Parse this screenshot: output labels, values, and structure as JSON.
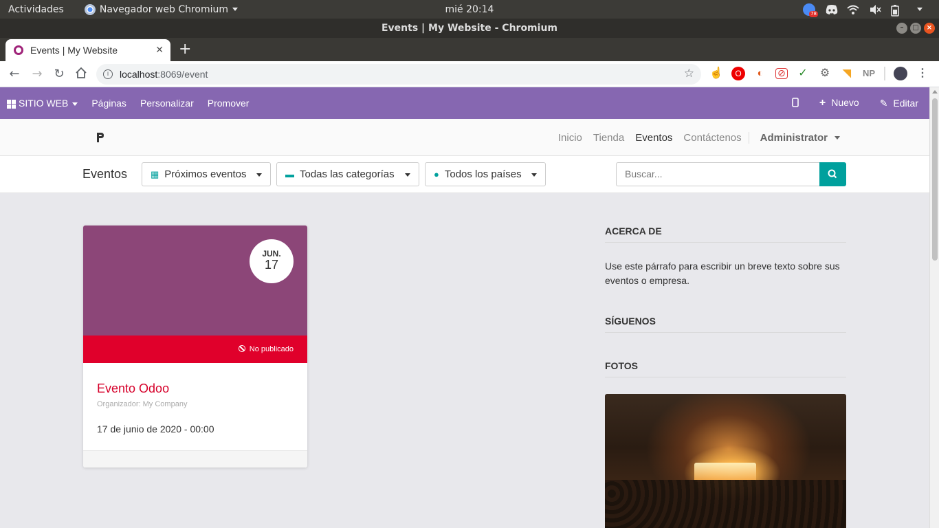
{
  "system": {
    "activities": "Actividades",
    "app_name": "Navegador web Chromium",
    "clock": "mié 20:14",
    "badge_count": "78"
  },
  "window": {
    "title": "Events | My Website - Chromium"
  },
  "browser": {
    "tab_title": "Events | My Website",
    "url_host": "localhost",
    "url_path": ":8069/event",
    "extensions": [
      "touch-icon",
      "opera-icon",
      "fire-icon",
      "pdf-icon",
      "vector-icon",
      "gear-icon",
      "rss-icon",
      "np-icon",
      "avatar-icon"
    ],
    "np_label": "NP"
  },
  "odoo_bar": {
    "site_web": "SITIO WEB",
    "paginas": "Páginas",
    "personalizar": "Personalizar",
    "promover": "Promover",
    "nuevo": "Nuevo",
    "editar": "Editar"
  },
  "site_nav": {
    "items": [
      "Inicio",
      "Tienda",
      "Eventos",
      "Contáctenos"
    ],
    "active": "Eventos",
    "user": "Administrator"
  },
  "filters": {
    "title": "Eventos",
    "upcoming": "Próximos eventos",
    "categories": "Todas las categorías",
    "countries": "Todos los países",
    "search_placeholder": "Buscar..."
  },
  "event": {
    "month": "JUN.",
    "day": "17",
    "status": "No publicado",
    "title": "Evento Odoo",
    "organizer": "Organizador: My Company",
    "datetime": "17 de junio de 2020 - 00:00"
  },
  "sidebar": {
    "about_title": "ACERCA DE",
    "about_text": "Use este párrafo para escribir un breve texto sobre sus eventos o empresa.",
    "follow_title": "SÍGUENOS",
    "photos_title": "FOTOS"
  },
  "colors": {
    "odoo_bar": "#8667b1",
    "cover": "#8c4678",
    "unpublished": "#e0002b",
    "accent": "#00a09d",
    "event_title": "#d6002a"
  }
}
